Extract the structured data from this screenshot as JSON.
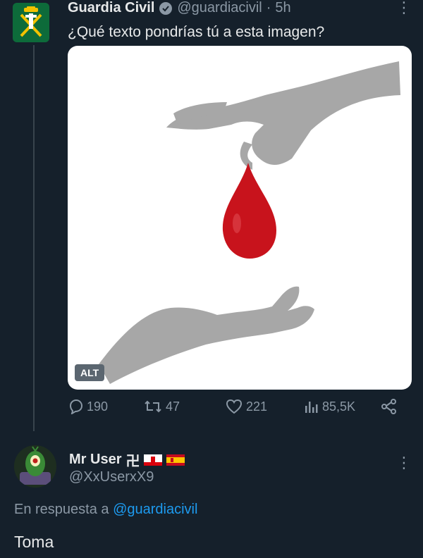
{
  "tweet": {
    "author_name": "Guardia Civil",
    "author_handle": "@guardiacivil",
    "separator": "·",
    "time": "5h",
    "text": "¿Qué texto pondrías tú a esta imagen?",
    "media": {
      "alt_badge": "ALT",
      "icon": "hands-blood-drop-illustration"
    },
    "stats": {
      "replies": "190",
      "retweets": "47",
      "likes": "221",
      "views": "85,5K"
    },
    "verified_icon": "verified-badge-icon"
  },
  "reply": {
    "author_name": "Mr User",
    "name_symbol": "卍",
    "flags": [
      "gibraltar-flag",
      "spain-flag"
    ],
    "author_handle": "@XxUserxX9",
    "in_reply_prefix": "En respuesta a",
    "in_reply_mention": "@guardiacivil",
    "text": "Toma"
  },
  "colors": {
    "background": "#15202b",
    "link": "#1d9bf0",
    "muted": "#8b98a5",
    "drop": "#c8131c"
  }
}
